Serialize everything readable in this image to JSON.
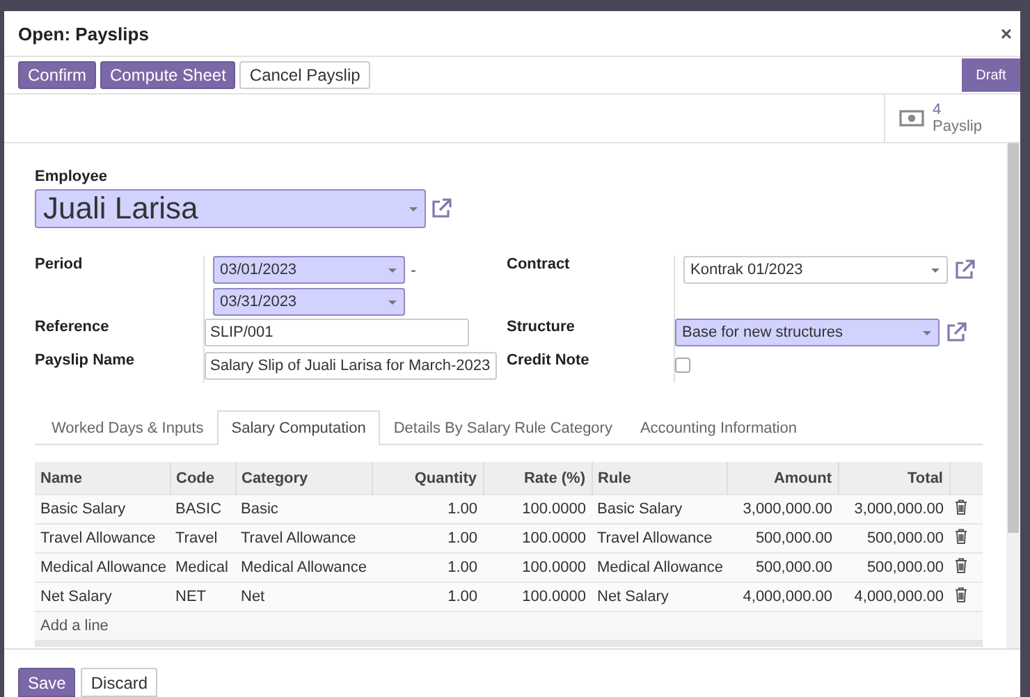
{
  "dialog": {
    "title": "Open: Payslips",
    "close": "×"
  },
  "toolbar": {
    "buttons": [
      {
        "label": "Confirm",
        "kind": "primary"
      },
      {
        "label": "Compute Sheet",
        "kind": "primary"
      },
      {
        "label": "Cancel Payslip",
        "kind": "secondary"
      }
    ],
    "status": "Draft"
  },
  "smart_button": {
    "count": "4",
    "label": "Payslip"
  },
  "employee": {
    "label": "Employee",
    "value": "Juali Larisa",
    "required": true
  },
  "period": {
    "label": "Period",
    "start": "03/01/2023",
    "end": "03/31/2023",
    "separator": "-",
    "required": true
  },
  "reference": {
    "label": "Reference",
    "value": "SLIP/001"
  },
  "payslip_name": {
    "label": "Payslip Name",
    "value": "Salary Slip of Juali Larisa for March-2023"
  },
  "contract": {
    "label": "Contract",
    "value": "Kontrak 01/2023",
    "required": false
  },
  "structure": {
    "label": "Structure",
    "value": "Base for new structures",
    "required": true
  },
  "credit_note": {
    "label": "Credit Note",
    "checked": false
  },
  "tabs": [
    {
      "label": "Worked Days & Inputs",
      "selected": false
    },
    {
      "label": "Salary Computation",
      "selected": true
    },
    {
      "label": "Details By Salary Rule Category",
      "selected": false
    },
    {
      "label": "Accounting Information",
      "selected": false
    }
  ],
  "table": {
    "columns": [
      "Name",
      "Code",
      "Category",
      "Quantity",
      "Rate (%)",
      "Rule",
      "Amount",
      "Total"
    ],
    "rows": [
      [
        "Basic Salary",
        "BASIC",
        "Basic",
        "1.00",
        "100.0000",
        "Basic Salary",
        "3,000,000.00",
        "3,000,000.00"
      ],
      [
        "Travel Allowance",
        "Travel",
        "Travel Allowance",
        "1.00",
        "100.0000",
        "Travel Allowance",
        "500,000.00",
        "500,000.00"
      ],
      [
        "Medical Allowance",
        "Medical",
        "Medical Allowance",
        "1.00",
        "100.0000",
        "Medical Allowance",
        "500,000.00",
        "500,000.00"
      ],
      [
        "Net Salary",
        "NET",
        "Net",
        "1.00",
        "100.0000",
        "Net Salary",
        "4,000,000.00",
        "4,000,000.00"
      ]
    ],
    "add_line": "Add a line"
  },
  "footer": {
    "buttons": [
      {
        "label": "Save",
        "kind": "primary"
      },
      {
        "label": "Discard",
        "kind": "secondary"
      }
    ]
  }
}
